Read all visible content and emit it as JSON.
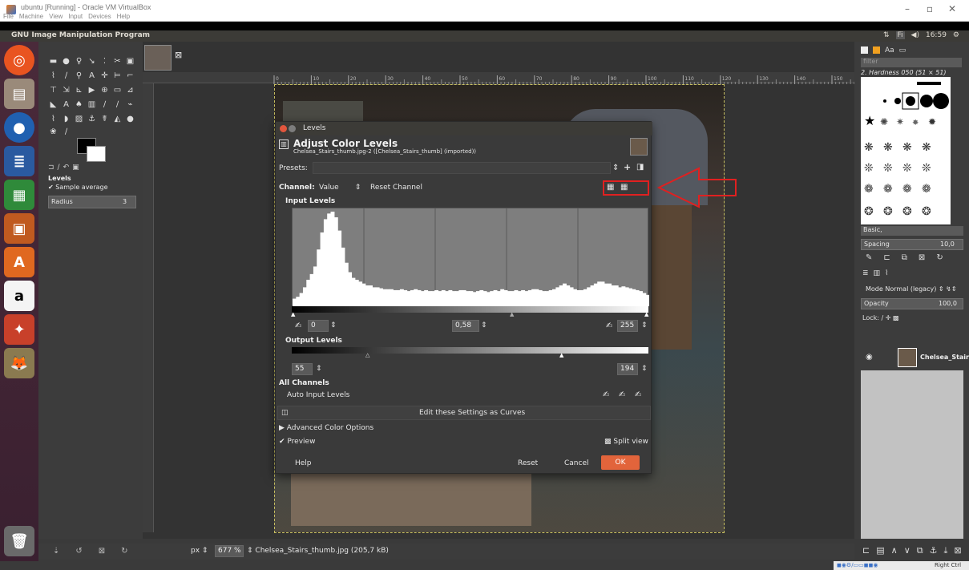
{
  "vbox": {
    "title": "ubuntu [Running] - Oracle VM VirtualBox",
    "menu": [
      "File",
      "Machine",
      "View",
      "Input",
      "Devices",
      "Help"
    ]
  },
  "panel": {
    "app_title": "GNU Image Manipulation Program",
    "keyboard": "Fi",
    "time": "16:59"
  },
  "toolbox": {
    "tool_options_title": "Levels",
    "sample_average": "Sample average",
    "radius_label": "Radius",
    "radius_value": "3"
  },
  "dialog": {
    "title": "Levels",
    "heading": "Adjust Color Levels",
    "subheading": "Chelsea_Stairs_thumb.jpg-2 ([Chelsea_Stairs_thumb] (imported))",
    "presets_label": "Presets:",
    "channel_label": "Channel:",
    "channel_value": "Value",
    "reset_channel": "Reset Channel",
    "input_levels": "Input Levels",
    "input_low": "0",
    "input_gamma": "0,58",
    "input_high": "255",
    "output_levels": "Output Levels",
    "output_low": "55",
    "output_high": "194",
    "all_channels": "All Channels",
    "auto_input": "Auto Input Levels",
    "edit_curves": "Edit these Settings as Curves",
    "advanced": "Advanced Color Options",
    "preview": "Preview",
    "split_view": "Split view",
    "help": "Help",
    "reset": "Reset",
    "cancel": "Cancel",
    "ok": "OK"
  },
  "histogram": {
    "values": [
      8,
      10,
      14,
      20,
      28,
      34,
      42,
      60,
      78,
      92,
      98,
      100,
      94,
      80,
      62,
      46,
      36,
      30,
      28,
      26,
      24,
      22,
      22,
      20,
      20,
      19,
      18,
      18,
      18,
      17,
      17,
      18,
      17,
      16,
      17,
      18,
      17,
      16,
      17,
      16,
      16,
      17,
      16,
      17,
      16,
      17,
      16,
      16,
      17,
      17,
      16,
      16,
      15,
      16,
      17,
      16,
      15,
      16,
      17,
      16,
      18,
      17,
      16,
      16,
      17,
      16,
      17,
      16,
      17,
      18,
      18,
      17,
      16,
      16,
      17,
      18,
      20,
      22,
      24,
      22,
      20,
      18,
      17,
      17,
      18,
      20,
      22,
      24,
      26,
      26,
      24,
      24,
      22,
      22,
      20,
      21,
      20,
      19,
      18,
      17,
      16,
      14,
      12
    ]
  },
  "right_dock": {
    "filter": "filter",
    "brush_name": "2. Hardness 050 (51 × 51)",
    "brush_set": "Basic,",
    "spacing_label": "Spacing",
    "spacing_value": "10,0",
    "mode_label": "Mode Normal (legacy)",
    "opacity_label": "Opacity",
    "opacity_value": "100,0",
    "lock_label": "Lock:",
    "layer_name": "Chelsea_Stairs"
  },
  "statusbar": {
    "unit": "px",
    "zoom": "677 %",
    "filename": "Chelsea_Stairs_thumb.jpg (205,7 kB)"
  },
  "tray": {
    "host_key": "Right Ctrl"
  },
  "ruler": {
    "ticks": [
      "0",
      "10",
      "20",
      "30",
      "40",
      "50",
      "60",
      "70",
      "80",
      "90",
      "100",
      "110",
      "120",
      "130",
      "140",
      "150"
    ]
  }
}
